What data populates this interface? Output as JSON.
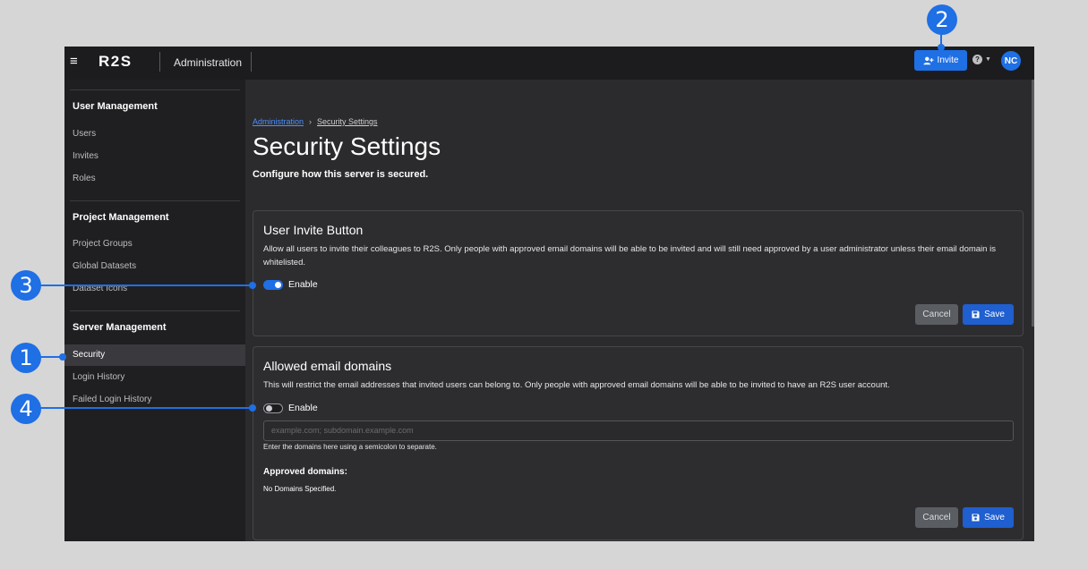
{
  "header": {
    "menu_icon": "hamburger-icon",
    "logo": "R2S",
    "app_name": "Administration",
    "invite_label": "Invite",
    "help_icon": "question-circle-icon",
    "avatar_initials": "NC",
    "accent_color": "#1f6fe5"
  },
  "sidebar": {
    "sections": [
      {
        "title": "User Management",
        "items": [
          "Users",
          "Invites",
          "Roles"
        ]
      },
      {
        "title": "Project Management",
        "items": [
          "Project Groups",
          "Global Datasets",
          "Dataset Icons"
        ]
      },
      {
        "title": "Server Management",
        "items": [
          "Security",
          "Login History",
          "Failed Login History"
        ]
      }
    ],
    "active_item": "Security"
  },
  "breadcrumb": {
    "parent": "Administration",
    "current": "Security Settings"
  },
  "page": {
    "title": "Security Settings",
    "subtitle": "Configure how this server is secured."
  },
  "invite_card": {
    "title": "User Invite Button",
    "description": "Allow all users to invite their colleagues to R2S. Only people with approved email domains will be able to be invited and will still need approved by a user administrator unless their email domain is whitelisted.",
    "toggle_label": "Enable",
    "toggle_on": true,
    "cancel_label": "Cancel",
    "save_label": "Save"
  },
  "domains_card": {
    "title": "Allowed email domains",
    "description": "This will restrict the email addresses that invited users can belong to. Only people with approved email domains will be able to be invited to have an R2S user account.",
    "toggle_label": "Enable",
    "toggle_on": false,
    "input_placeholder": "example.com; subdomain.example.com",
    "input_hint": "Enter the domains here using a semicolon to separate.",
    "approved_label": "Approved domains:",
    "approved_value": "No Domains Specified.",
    "cancel_label": "Cancel",
    "save_label": "Save"
  },
  "callouts": [
    "1",
    "2",
    "3",
    "4"
  ]
}
